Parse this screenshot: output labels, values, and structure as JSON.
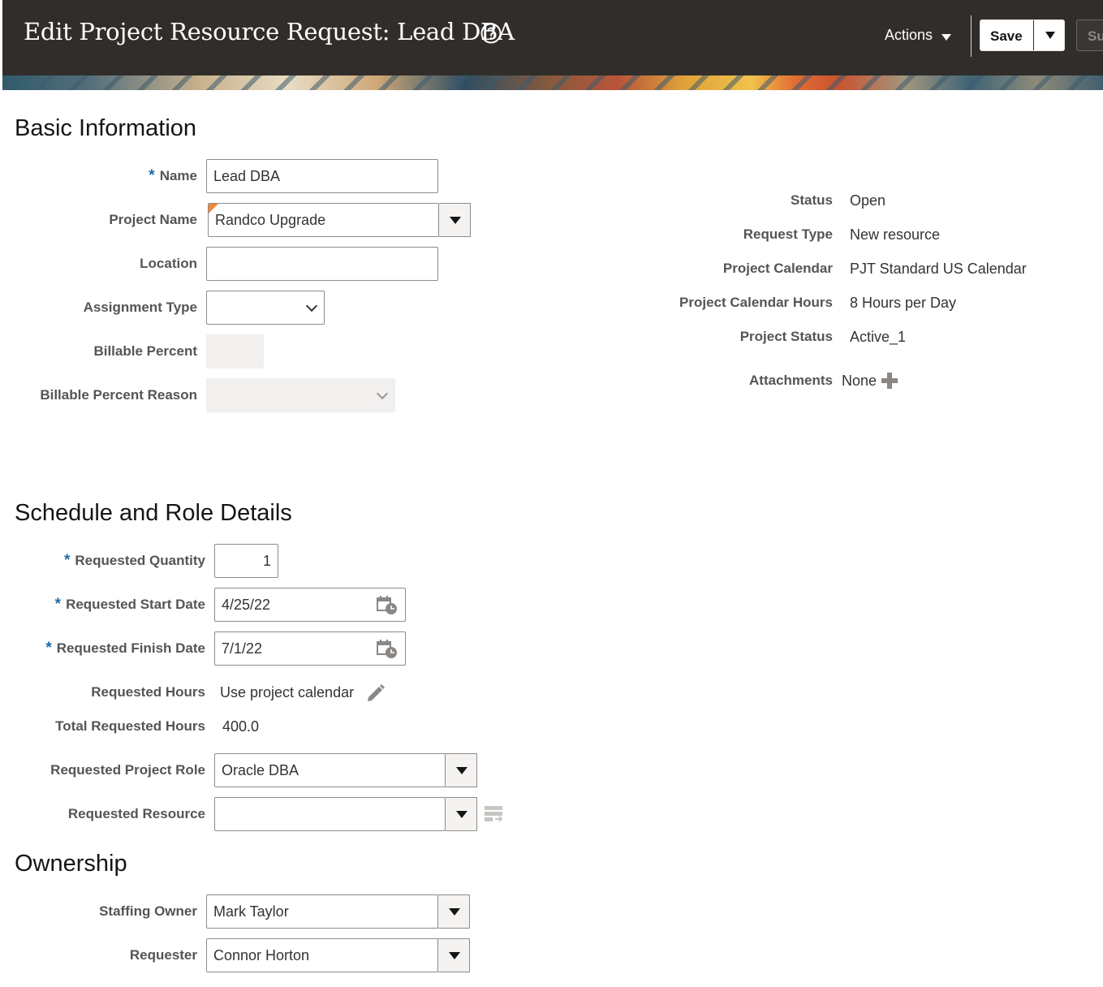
{
  "header": {
    "title": "Edit Project Resource Request: Lead DBA",
    "actions_label": "Actions",
    "save_label": "Save",
    "submit_label": "Su"
  },
  "basic_information": {
    "section_title": "Basic Information",
    "name": {
      "label": "Name",
      "value": "Lead DBA",
      "required": true
    },
    "project_name": {
      "label": "Project Name",
      "value": "Randco Upgrade"
    },
    "location": {
      "label": "Location",
      "value": ""
    },
    "assignment_type": {
      "label": "Assignment Type",
      "value": ""
    },
    "billable_percent": {
      "label": "Billable Percent",
      "value": ""
    },
    "billable_percent_reason": {
      "label": "Billable Percent Reason",
      "value": ""
    }
  },
  "details": {
    "status": {
      "label": "Status",
      "value": "Open"
    },
    "request_type": {
      "label": "Request Type",
      "value": "New resource"
    },
    "project_calendar": {
      "label": "Project Calendar",
      "value": "PJT Standard US Calendar"
    },
    "project_calendar_hours": {
      "label": "Project Calendar Hours",
      "value": "8 Hours per Day"
    },
    "project_status": {
      "label": "Project Status",
      "value": "Active_1"
    },
    "attachments": {
      "label": "Attachments",
      "value": "None"
    }
  },
  "schedule": {
    "section_title": "Schedule and Role Details",
    "requested_quantity": {
      "label": "Requested Quantity",
      "value": "1"
    },
    "requested_start_date": {
      "label": "Requested Start Date",
      "value": "4/25/22"
    },
    "requested_finish_date": {
      "label": "Requested Finish Date",
      "value": "7/1/22"
    },
    "requested_hours": {
      "label": "Requested Hours",
      "value": "Use project calendar"
    },
    "total_requested_hours": {
      "label": "Total Requested Hours",
      "value": "400.0"
    },
    "requested_project_role": {
      "label": "Requested Project Role",
      "value": "Oracle DBA"
    },
    "requested_resource": {
      "label": "Requested Resource",
      "value": ""
    }
  },
  "ownership": {
    "section_title": "Ownership",
    "staffing_owner": {
      "label": "Staffing Owner",
      "value": "Mark Taylor"
    },
    "requester": {
      "label": "Requester",
      "value": "Connor Horton"
    }
  },
  "required_marker": "*",
  "colors": {
    "header_bg": "#312d2a",
    "required": "#1d6aa8",
    "flag": "#f0883e"
  },
  "icons": [
    "help-icon",
    "chevron-down-icon",
    "calendar-icon",
    "pencil-icon",
    "add-icon",
    "resource-search-icon"
  ]
}
